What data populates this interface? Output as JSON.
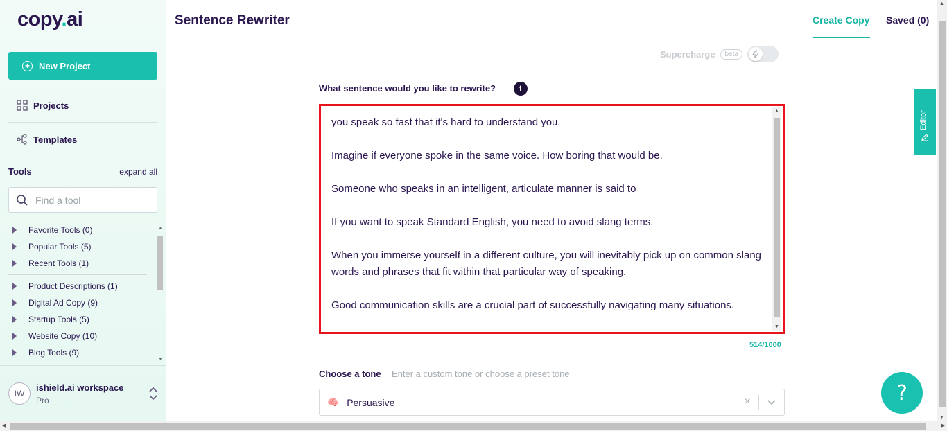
{
  "brand": {
    "logo_left": "copy",
    "logo_dot": ".",
    "logo_right": "ai",
    "accent": "#1bbfad",
    "alert_border": "#e8141c"
  },
  "sidebar": {
    "new_project": "New Project",
    "nav": [
      {
        "label": "Projects",
        "icon": "grid-icon"
      },
      {
        "label": "Templates",
        "icon": "templates-icon"
      }
    ],
    "tools_title": "Tools",
    "expand_all": "expand all",
    "search_placeholder": "Find a tool",
    "tool_groups": [
      "Favorite Tools (0)",
      "Popular Tools (5)",
      "Recent Tools (1)",
      "Product Descriptions (1)",
      "Digital Ad Copy (9)",
      "Startup Tools (5)",
      "Website Copy (10)",
      "Blog Tools (9)"
    ],
    "workspace": {
      "initials": "IW",
      "name": "ishield.ai workspace",
      "plan": "Pro"
    }
  },
  "header": {
    "title": "Sentence Rewriter",
    "tab_create": "Create Copy",
    "tab_saved": "Saved (0)"
  },
  "main": {
    "supercharge_label": "Supercharge",
    "beta_label": "beta",
    "supercharge_on": false,
    "question_label": "What sentence would you like to rewrite?",
    "info_glyph": "i",
    "sentence_text": "you speak so fast that it's hard to understand you.\n\nImagine if everyone spoke in the same voice. How boring that would be.\n\nSomeone who speaks in an intelligent, articulate manner is said to\n\nIf you want to speak Standard English, you need to avoid slang terms.\n\nWhen you immerse yourself in a different culture, you will inevitably pick up on common slang words and phrases that fit within that particular way of speaking.\n\nGood communication skills are a crucial part of successfully navigating many situations.",
    "char_count": "514/1000",
    "tone_label": "Choose a tone",
    "tone_hint": "Enter a custom tone or choose a preset tone",
    "tone_emoji": "🧠",
    "tone_value": "Persuasive",
    "tone_clear": "×"
  },
  "right": {
    "editor_tab": "Editor",
    "help": "?"
  }
}
